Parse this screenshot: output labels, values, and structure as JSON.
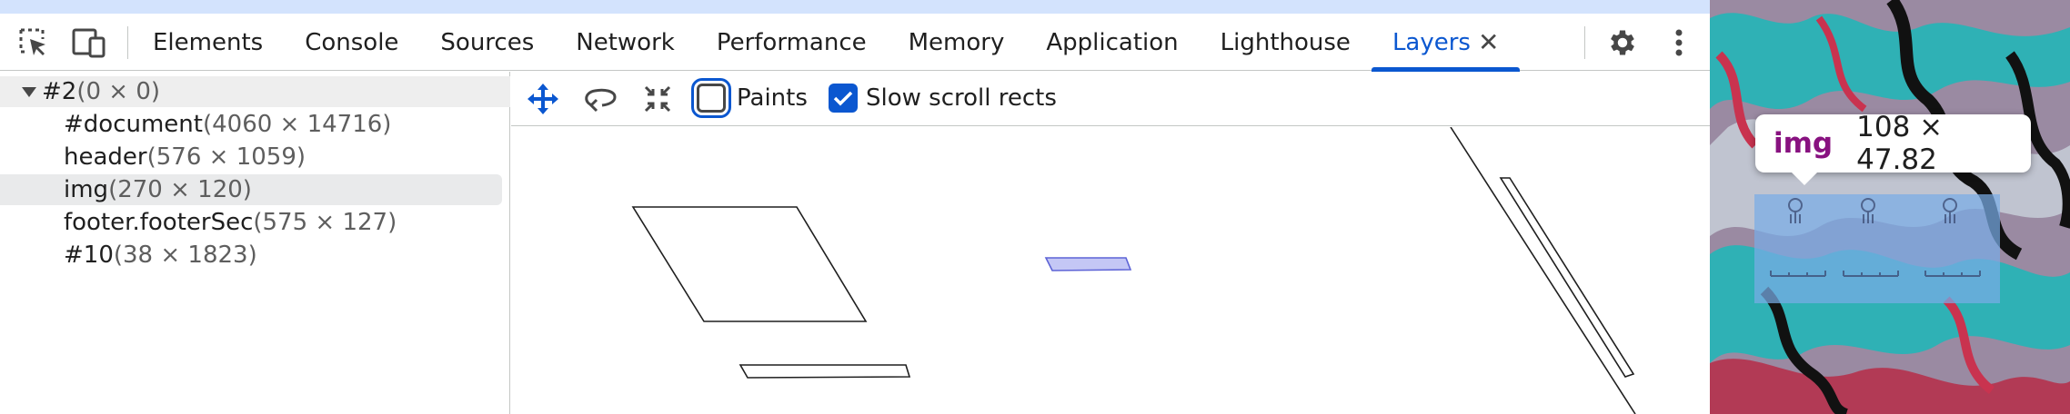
{
  "toolbar": {
    "tabs": [
      {
        "label": "Elements"
      },
      {
        "label": "Console"
      },
      {
        "label": "Sources"
      },
      {
        "label": "Network"
      },
      {
        "label": "Performance"
      },
      {
        "label": "Memory"
      },
      {
        "label": "Application"
      },
      {
        "label": "Lighthouse"
      },
      {
        "label": "Layers",
        "active": true
      }
    ],
    "close_glyph": "✕",
    "icons": [
      "inspect-element-icon",
      "device-toolbar-icon",
      "gear-icon",
      "more-vert-icon"
    ]
  },
  "layer_tree": {
    "rows": [
      {
        "name": "#2",
        "dims": "(0 × 0)"
      },
      {
        "name": "#document",
        "dims": "(4060 × 14716)"
      },
      {
        "name": "header",
        "dims": "(576 × 1059)"
      },
      {
        "name": "img",
        "dims": "(270 × 120)"
      },
      {
        "name": "footer.footerSec",
        "dims": "(575 × 127)"
      },
      {
        "name": "#10",
        "dims": "(38 × 1823)"
      }
    ]
  },
  "view_toolbar": {
    "icons": [
      "pan-mode-icon",
      "rotate-mode-icon",
      "reset-transform-icon"
    ],
    "paints": {
      "label": "Paints",
      "checked": false
    },
    "slow_scroll": {
      "label": "Slow scroll rects",
      "checked": true
    }
  },
  "tooltip": {
    "tag": "img",
    "size": "108 × 47.82"
  },
  "colors": {
    "accent": "#0b57d0",
    "top_strip": "#d3e3fd",
    "tag_color": "#881280",
    "highlight": "#78ace6"
  }
}
